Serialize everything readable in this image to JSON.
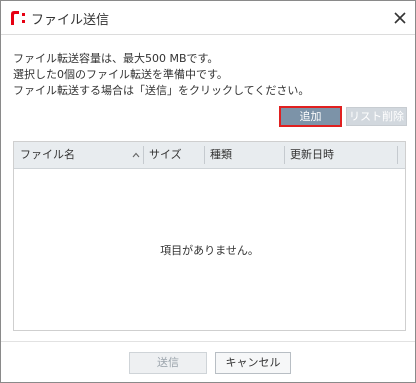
{
  "dialog": {
    "title": "ファイル送信",
    "logo_text": "R:"
  },
  "messages": [
    "ファイル転送容量は、最大500 MBです。",
    "選択した0個のファイル転送を準備中です。",
    "ファイル転送する場合は「送信」をクリックしてください。"
  ],
  "toolbar": {
    "add_label": "追加",
    "remove_label": "リスト削除"
  },
  "table": {
    "columns": [
      "ファイル名",
      "サイズ",
      "種類",
      "更新日時"
    ],
    "empty_text": "項目がありません。"
  },
  "footer": {
    "send_label": "送信",
    "cancel_label": "キャンセル"
  },
  "colors": {
    "accent_red": "#e02020",
    "add_button_bg": "#7c93a8",
    "header_bg": "#e8ecef"
  },
  "icons": {
    "logo": "brand-logo-icon",
    "close": "close-icon",
    "sort": "sort-asc-icon"
  }
}
